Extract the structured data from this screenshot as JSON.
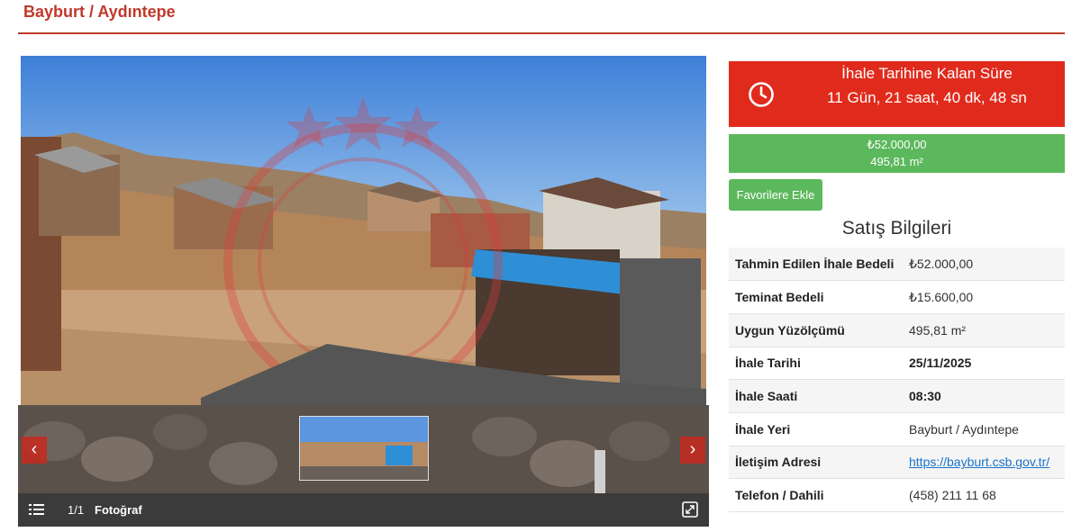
{
  "page": {
    "title": "Bayburt / Aydıntepe"
  },
  "gallery": {
    "counter": "1/1",
    "label": "Fotoğraf",
    "prev_label": "‹",
    "next_label": "›"
  },
  "countdown": {
    "title": "İhale Tarihine Kalan Süre",
    "time": "11 Gün, 21 saat, 40 dk, 48 sn"
  },
  "price": {
    "amount": "₺52.000,00",
    "area": "495,81 m²"
  },
  "favorites_button": "Favorilere Ekle",
  "sales_info": {
    "title": "Satış Bilgileri",
    "rows": [
      {
        "label": "Tahmin Edilen İhale Bedeli",
        "value": "₺52.000,00"
      },
      {
        "label": "Teminat Bedeli",
        "value": "₺15.600,00"
      },
      {
        "label": "Uygun Yüzölçümü",
        "value": "495,81 m²"
      },
      {
        "label": "İhale Tarihi",
        "value": "25/11/2025"
      },
      {
        "label": "İhale Saati",
        "value": "08:30"
      },
      {
        "label": "İhale Yeri",
        "value": "Bayburt / Aydıntepe"
      },
      {
        "label": "İletişim Adresi",
        "value": "https://bayburt.csb.gov.tr/"
      },
      {
        "label": "Telefon / Dahili",
        "value": "(458) 211 11 68"
      }
    ]
  },
  "icons": {
    "clock": "clock-icon",
    "menu": "list-icon",
    "expand": "expand-icon",
    "prev": "chevron-left-icon",
    "next": "chevron-right-icon"
  },
  "colors": {
    "accent": "#c0392b",
    "countdown_bg": "#e02b1c",
    "green": "#5cb85c",
    "link": "#1a73c8"
  }
}
